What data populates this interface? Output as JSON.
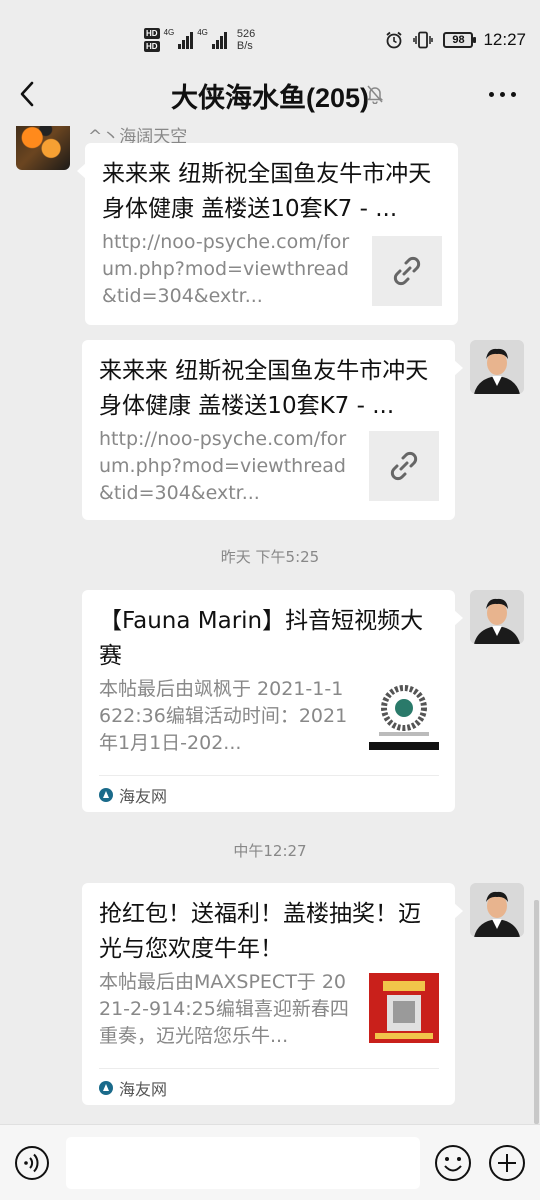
{
  "status_bar": {
    "hd1": "HD",
    "hd2": "HD",
    "net1": "4G",
    "net2": "4G",
    "speed_value": "526",
    "speed_unit": "B/s",
    "battery": "98",
    "time": "12:27"
  },
  "header": {
    "title": "大侠海水鱼(205)",
    "back_icon": "chevron-left-icon",
    "mute_icon": "bell-off-icon",
    "more_icon": "more-dots-icon"
  },
  "messages": [
    {
      "side": "left",
      "sender": "^丶海阔天空",
      "title": "来来来 纽斯祝全国鱼友牛市冲天 身体健康 盖楼送10套K7 - ...",
      "desc": "http://noo-psyche.com/forum.php?mod=viewthread&tid=304&extr...",
      "thumb_icon": "link-icon"
    },
    {
      "side": "right",
      "title": "来来来 纽斯祝全国鱼友牛市冲天 身体健康 盖楼送10套K7 - ...",
      "desc": "http://noo-psyche.com/forum.php?mod=viewthread&tid=304&extr...",
      "thumb_icon": "link-icon"
    },
    {
      "timestamp": "昨天 下午5:25"
    },
    {
      "side": "right",
      "title": "【Fauna Marin】抖音短视频大赛",
      "desc": "本帖最后由飒枫于 2021-1-1622:36编辑活动时间：2021年1月1日-202...",
      "source": "海友网"
    },
    {
      "timestamp": "中午12:27"
    },
    {
      "side": "right",
      "title": "抢红包！送福利！盖楼抽奖！迈光与您欢度牛年！",
      "desc": "本帖最后由MAXSPECT于 2021-2-914:25编辑喜迎新春四重奏，迈光陪您乐牛...",
      "source": "海友网"
    }
  ],
  "input_bar": {
    "voice_icon": "voice-icon",
    "placeholder": "",
    "emoji_icon": "emoji-icon",
    "plus_icon": "plus-icon"
  }
}
